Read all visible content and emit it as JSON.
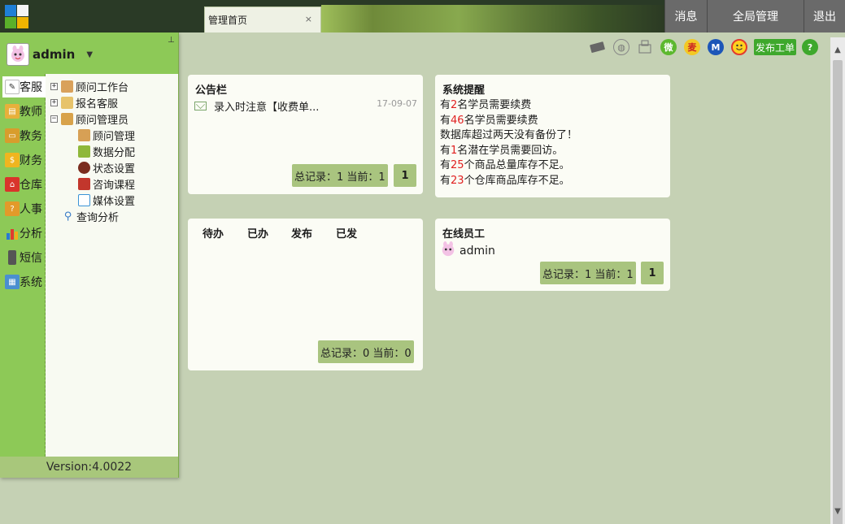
{
  "tabs": [
    {
      "label": "管理首页",
      "close": "×"
    }
  ],
  "topnav": {
    "messages": "消息",
    "global_admin": "全局管理",
    "logout": "退出"
  },
  "user": {
    "name": "admin",
    "dropdown": "▼",
    "pin": "⊥"
  },
  "categories": [
    {
      "label": "客服",
      "icon": "pen-icon",
      "active": true
    },
    {
      "label": "教师",
      "icon": "book-icon"
    },
    {
      "label": "教务",
      "icon": "folder-icon"
    },
    {
      "label": "财务",
      "icon": "coins-icon"
    },
    {
      "label": "仓库",
      "icon": "house-icon"
    },
    {
      "label": "人事",
      "icon": "person-icon"
    },
    {
      "label": "分析",
      "icon": "bar-chart-icon"
    },
    {
      "label": "短信",
      "icon": "phone-icon"
    },
    {
      "label": "系统",
      "icon": "system-icon"
    }
  ],
  "tree": [
    {
      "label": "顾问工作台",
      "toggle": "+",
      "level": 0
    },
    {
      "label": "报名客服",
      "toggle": "+",
      "level": 0
    },
    {
      "label": "顾问管理员",
      "toggle": "−",
      "level": 0
    },
    {
      "label": "顾问管理",
      "level": 1
    },
    {
      "label": "数据分配",
      "level": 1
    },
    {
      "label": "状态设置",
      "level": 1
    },
    {
      "label": "咨询课程",
      "level": 1
    },
    {
      "label": "媒体设置",
      "level": 1
    },
    {
      "label": "查询分析",
      "level": 0
    }
  ],
  "version": "Version:4.0022",
  "toolbar": {
    "icons": [
      "card-icon",
      "globe-icon",
      "fax-icon",
      "weixin-icon",
      "mai-icon",
      "m-icon",
      "smiley-icon"
    ],
    "weixin": "微",
    "mai": "麦",
    "m": "M",
    "publish": "发布工单",
    "help": "?"
  },
  "notice": {
    "title": "公告栏",
    "items": [
      {
        "text": "录入时注意【收费单...",
        "date": "17-09-07"
      }
    ],
    "pager_info": "总记录：1 当前：1",
    "page": "1"
  },
  "reminders": {
    "title": "系统提醒",
    "lines": [
      {
        "pre": "有",
        "num": "2",
        "post": "名学员需要续费"
      },
      {
        "pre": "有",
        "num": "46",
        "post": "名学员需要续费"
      },
      {
        "pre": "数据库超过两天没有备份了！",
        "num": "",
        "post": ""
      },
      {
        "pre": "有",
        "num": "1",
        "post": "名潜在学员需要回访。"
      },
      {
        "pre": "有",
        "num": "25",
        "post": "个商品总量库存不足。"
      },
      {
        "pre": "有",
        "num": "23",
        "post": "个仓库商品库存不足。"
      }
    ]
  },
  "tasks": {
    "tabs": [
      "待办",
      "已办",
      "发布",
      "已发"
    ],
    "pager_info": "总记录：0 当前：0"
  },
  "online": {
    "title": "在线员工",
    "users": [
      "admin"
    ],
    "pager_info": "总记录：1 当前：1",
    "page": "1"
  },
  "scrollbar": {
    "up": "▲",
    "down": "▼"
  }
}
